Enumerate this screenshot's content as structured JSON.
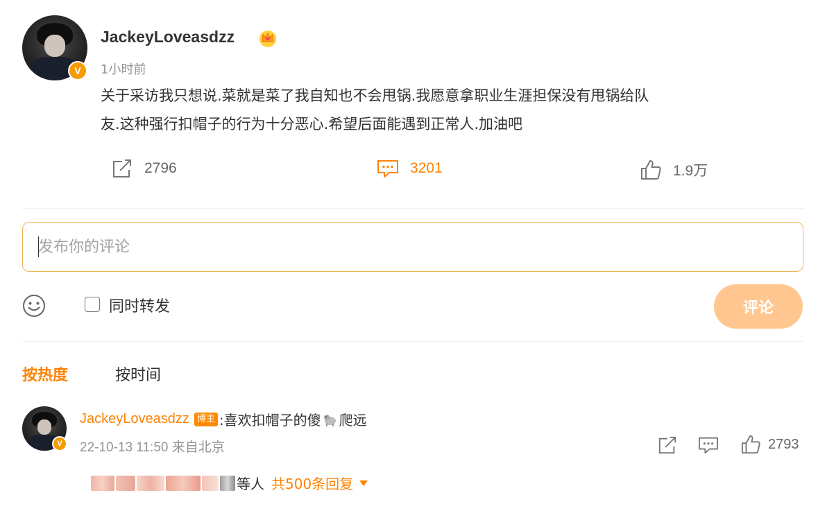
{
  "post": {
    "username": "JackeyLoveasdzz",
    "verified_badge": "V",
    "crown_icon": "crown-icon",
    "time": "1小时前",
    "content_line1": "关于采访我只想说.菜就是菜了我自知也不会甩锅.我愿意拿职业生涯担保没有甩锅给队",
    "content_line2": "友.这种强行扣帽子的行为十分恶心.希望后面能遇到正常人.加油吧",
    "reposts": "2796",
    "comments": "3201",
    "likes": "1.9万"
  },
  "composer": {
    "placeholder": "发布你的评论",
    "repost_label": "同时转发",
    "repost_checked": false,
    "submit_label": "评论"
  },
  "sort_tabs": {
    "hot": "按热度",
    "time": "按时间",
    "active": "hot"
  },
  "comment": {
    "username": "JackeyLoveasdzz",
    "tag": "博主",
    "text_before": ":喜欢扣帽子的傻",
    "text_after": "爬远",
    "emoji": "dog-emoji",
    "meta": "22-10-13 11:50 来自北京",
    "likes": "2793",
    "replies_suffix": "等人",
    "replies_link": "共500条回复"
  },
  "colors": {
    "accent": "#ff8200",
    "submit_bg": "#ffc68f",
    "composer_border": "#f0b356",
    "verified": "#f59d00",
    "muted": "#939393"
  }
}
